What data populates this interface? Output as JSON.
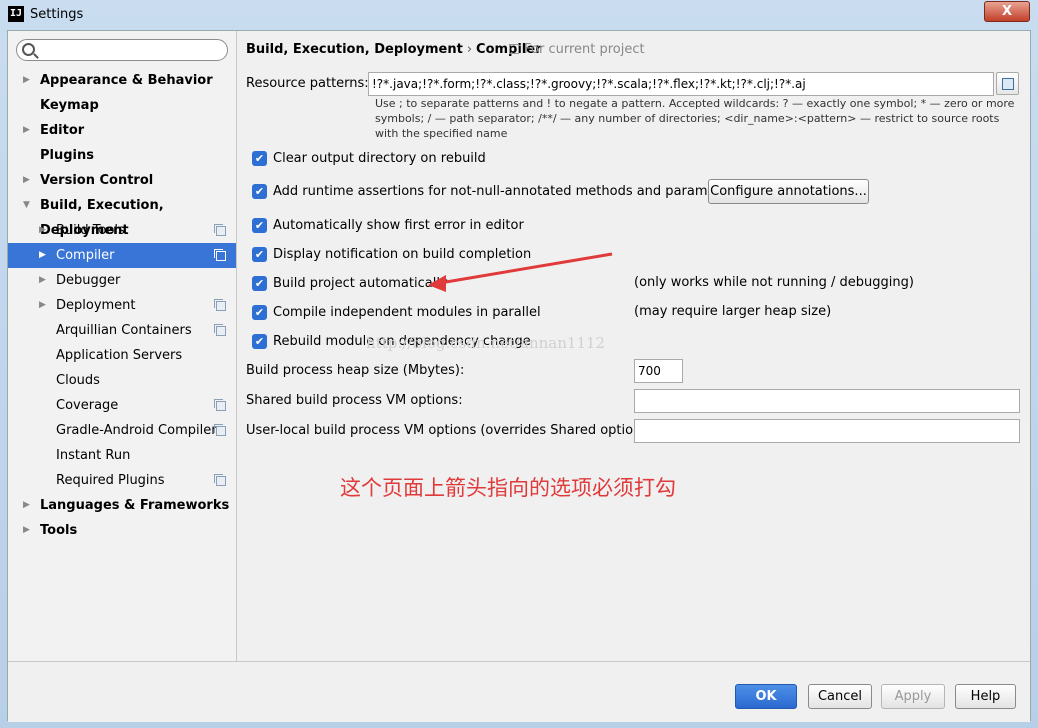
{
  "window": {
    "title": "Settings",
    "close_label": "X"
  },
  "sidebar": {
    "search_placeholder": "",
    "items": [
      {
        "label": "Appearance & Behavior",
        "level": 0,
        "expandable": true
      },
      {
        "label": "Keymap",
        "level": 0,
        "expandable": false
      },
      {
        "label": "Editor",
        "level": 0,
        "expandable": true
      },
      {
        "label": "Plugins",
        "level": 0,
        "expandable": false
      },
      {
        "label": "Version Control",
        "level": 0,
        "expandable": true
      },
      {
        "label": "Build, Execution, Deployment",
        "level": 0,
        "expandable": true,
        "expanded": true
      },
      {
        "label": "Build Tools",
        "level": 1,
        "expandable": true,
        "project_icon": true
      },
      {
        "label": "Compiler",
        "level": 1,
        "expandable": true,
        "selected": true,
        "project_icon": true
      },
      {
        "label": "Debugger",
        "level": 1,
        "expandable": true
      },
      {
        "label": "Deployment",
        "level": 1,
        "expandable": true,
        "project_icon": true
      },
      {
        "label": "Arquillian Containers",
        "level": 1,
        "project_icon": true
      },
      {
        "label": "Application Servers",
        "level": 1
      },
      {
        "label": "Clouds",
        "level": 1
      },
      {
        "label": "Coverage",
        "level": 1,
        "project_icon": true
      },
      {
        "label": "Gradle-Android Compiler",
        "level": 1,
        "project_icon": true
      },
      {
        "label": "Instant Run",
        "level": 1
      },
      {
        "label": "Required Plugins",
        "level": 1,
        "project_icon": true
      },
      {
        "label": "Languages & Frameworks",
        "level": 0,
        "expandable": true
      },
      {
        "label": "Tools",
        "level": 0,
        "expandable": true
      }
    ]
  },
  "main": {
    "breadcrumb": {
      "parent": "Build, Execution, Deployment",
      "separator": "›",
      "current": "Compiler"
    },
    "for_current_project": "For current project",
    "resource_patterns": {
      "label": "Resource patterns:",
      "value": "!?*.java;!?*.form;!?*.class;!?*.groovy;!?*.scala;!?*.flex;!?*.kt;!?*.clj;!?*.aj",
      "hint": "Use ; to separate patterns and ! to negate a pattern. Accepted wildcards: ? — exactly one symbol; * — zero or more symbols; / — path separator; /**/ — any number of directories; <dir_name>:<pattern> — restrict to source roots with the specified name"
    },
    "checkboxes": [
      {
        "label": "Clear output directory on rebuild",
        "checked": true
      },
      {
        "label": "Add runtime assertions for not-null-annotated methods and parameters",
        "checked": true
      },
      {
        "label": "Automatically show first error in editor",
        "checked": true
      },
      {
        "label": "Display notification on build completion",
        "checked": true
      },
      {
        "label": "Build project automatically",
        "checked": true,
        "note": "(only works while not running / debugging)"
      },
      {
        "label": "Compile independent modules in parallel",
        "checked": true,
        "note": "(may require larger heap size)"
      },
      {
        "label": "Rebuild module on dependency change",
        "checked": true
      }
    ],
    "configure_annotations_label": "Configure annotations...",
    "heap_size": {
      "label": "Build process heap size (Mbytes):",
      "value": "700"
    },
    "shared_vm": {
      "label": "Shared build process VM options:",
      "value": ""
    },
    "user_vm": {
      "label": "User-local build process VM options (overrides Shared options):",
      "value": ""
    },
    "annotation_text": "这个页面上箭头指向的选项必须打勾",
    "watermark": "http://blog.csdn.net/annan1112",
    "annotation_color": "#e03a3a"
  },
  "footer": {
    "ok": "OK",
    "cancel": "Cancel",
    "apply": "Apply",
    "help": "Help"
  },
  "colors": {
    "selection": "#3875d7",
    "checkbox": "#2d6fd2",
    "ok_button": "#2a6ad0"
  }
}
